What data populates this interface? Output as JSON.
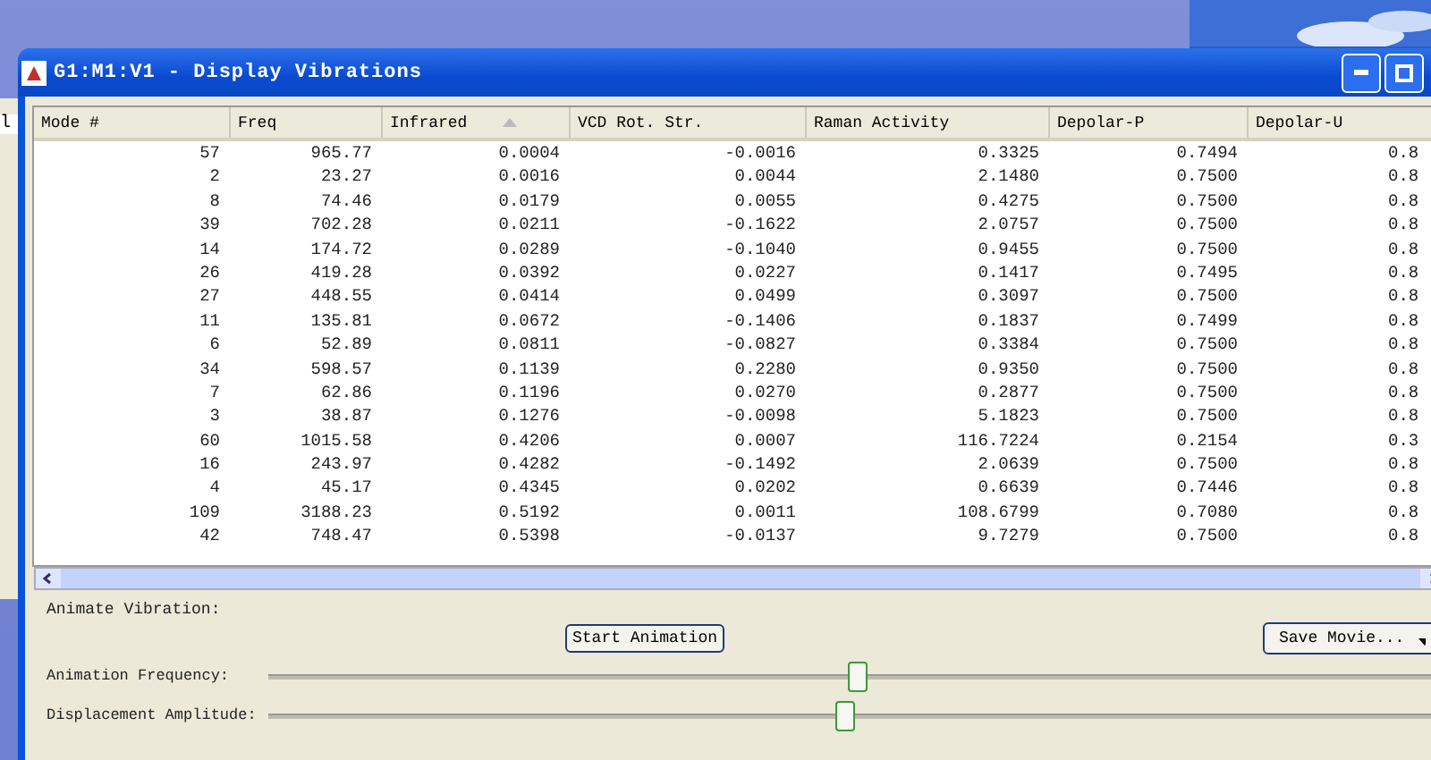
{
  "background_window": {
    "text": "l"
  },
  "window": {
    "title": "G1:M1:V1 - Display Vibrations"
  },
  "table": {
    "columns": [
      {
        "label": "Mode #",
        "sorted": false
      },
      {
        "label": "Freq",
        "sorted": false
      },
      {
        "label": "Infrared",
        "sorted": true
      },
      {
        "label": "VCD Rot. Str.",
        "sorted": false
      },
      {
        "label": "Raman Activity",
        "sorted": false
      },
      {
        "label": "Depolar-P",
        "sorted": false
      },
      {
        "label": "Depolar-U",
        "sorted": false
      }
    ],
    "rows": [
      [
        "57",
        "965.77",
        "0.0004",
        "-0.0016",
        "0.3325",
        "0.7494",
        "0.8"
      ],
      [
        "2",
        "23.27",
        "0.0016",
        "0.0044",
        "2.1480",
        "0.7500",
        "0.8"
      ],
      [
        "8",
        "74.46",
        "0.0179",
        "0.0055",
        "0.4275",
        "0.7500",
        "0.8"
      ],
      [
        "39",
        "702.28",
        "0.0211",
        "-0.1622",
        "2.0757",
        "0.7500",
        "0.8"
      ],
      [
        "14",
        "174.72",
        "0.0289",
        "-0.1040",
        "0.9455",
        "0.7500",
        "0.8"
      ],
      [
        "26",
        "419.28",
        "0.0392",
        "0.0227",
        "0.1417",
        "0.7495",
        "0.8"
      ],
      [
        "27",
        "448.55",
        "0.0414",
        "0.0499",
        "0.3097",
        "0.7500",
        "0.8"
      ],
      [
        "11",
        "135.81",
        "0.0672",
        "-0.1406",
        "0.1837",
        "0.7499",
        "0.8"
      ],
      [
        "6",
        "52.89",
        "0.0811",
        "-0.0827",
        "0.3384",
        "0.7500",
        "0.8"
      ],
      [
        "34",
        "598.57",
        "0.1139",
        "0.2280",
        "0.9350",
        "0.7500",
        "0.8"
      ],
      [
        "7",
        "62.86",
        "0.1196",
        "0.0270",
        "0.2877",
        "0.7500",
        "0.8"
      ],
      [
        "3",
        "38.87",
        "0.1276",
        "-0.0098",
        "5.1823",
        "0.7500",
        "0.8"
      ],
      [
        "60",
        "1015.58",
        "0.4206",
        "0.0007",
        "116.7224",
        "0.2154",
        "0.3"
      ],
      [
        "16",
        "243.97",
        "0.4282",
        "-0.1492",
        "2.0639",
        "0.7500",
        "0.8"
      ],
      [
        "4",
        "45.17",
        "0.4345",
        "0.0202",
        "0.6639",
        "0.7446",
        "0.8"
      ],
      [
        "109",
        "3188.23",
        "0.5192",
        "0.0011",
        "108.6799",
        "0.7080",
        "0.8"
      ],
      [
        "42",
        "748.47",
        "0.5398",
        "-0.0137",
        "9.7279",
        "0.7500",
        "0.8"
      ]
    ]
  },
  "animate": {
    "group_label": "Animate Vibration:",
    "start_button": "Start Animation",
    "save_button": "Save Movie..."
  },
  "sliders": [
    {
      "label": "Animation Frequency:",
      "level": 0.5
    },
    {
      "label": "Displacement Amplitude:",
      "level": 0.49
    }
  ]
}
